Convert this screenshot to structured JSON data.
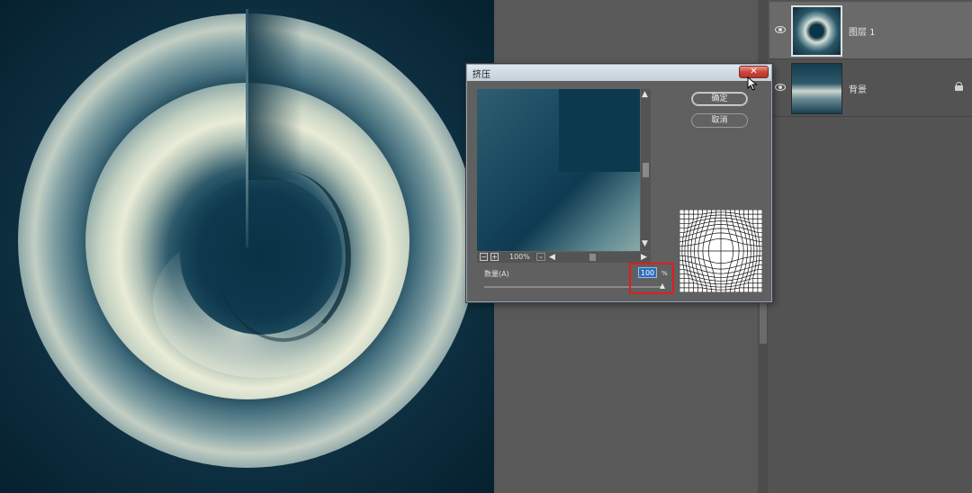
{
  "dialog": {
    "title": "挤压",
    "close_glyph": "✕",
    "ok_label": "确定",
    "cancel_label": "取消",
    "zoom": {
      "value": "100%",
      "zoom_out_glyph": "−",
      "zoom_in_glyph": "+",
      "dropdown_glyph": "⌄"
    },
    "scroll_glyphs": {
      "up": "▲",
      "down": "▼",
      "left": "◀",
      "right": "▶"
    },
    "amount": {
      "label": "数量(A)",
      "value": "100",
      "unit": "%",
      "level_percent": 100
    }
  },
  "layers": [
    {
      "name": "图层 1",
      "selected": true,
      "visible": true,
      "locked": false
    },
    {
      "name": "背景",
      "selected": false,
      "visible": true,
      "locked": true
    }
  ],
  "icons": {
    "eye": "eye-icon",
    "lock": "lock-icon",
    "close": "close-icon",
    "cursor": "mouse-cursor-icon"
  },
  "colors": {
    "highlight": "#e21d1d",
    "input_selection": "#2f6dbd",
    "close_button": "#c9483a"
  }
}
